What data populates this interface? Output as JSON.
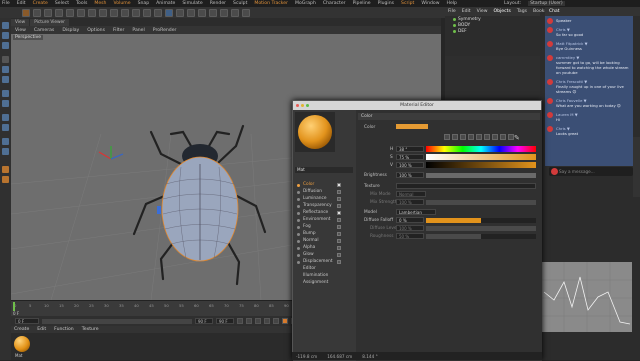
{
  "menubar": [
    "File",
    "Edit",
    "Create",
    "Select",
    "Tools",
    "Mesh",
    "Volume",
    "Snap",
    "Animate",
    "Simulate",
    "Render",
    "Sculpt",
    "Motion Tracker",
    "MoGraph",
    "Character",
    "Pipeline",
    "Plugins",
    "Script",
    "Window",
    "Help"
  ],
  "menubar_right": "Layout:",
  "layout_value": "Startup (User)",
  "viewport": {
    "tabs": [
      "View",
      "Picture Viewer"
    ],
    "menu": [
      "View",
      "Cameras",
      "Display",
      "Options",
      "Filter",
      "Panel",
      "ProRender"
    ],
    "camera_label": "Perspective"
  },
  "timeline": {
    "ticks": [
      "0",
      "5",
      "10",
      "15",
      "20",
      "25",
      "30",
      "35",
      "40",
      "45",
      "50",
      "55",
      "60",
      "65",
      "70",
      "75",
      "80",
      "85",
      "90"
    ],
    "current_frame": "0 F",
    "start_field": "0 F",
    "end_field": "90 F",
    "end_field2": "90 F"
  },
  "material_manager": {
    "menu": [
      "Create",
      "Edit",
      "Function",
      "Texture"
    ],
    "material_label": "Mat"
  },
  "objects_panel": {
    "tabs": [
      "File",
      "Edit",
      "View",
      "Objects",
      "Tags",
      "Bookmarks"
    ],
    "items": [
      "Symmetry",
      "BODY",
      "DEF"
    ]
  },
  "chat": {
    "header": "Chat",
    "messages": [
      {
        "name": "Speaker",
        "text": "Speaker"
      },
      {
        "name": "Chris ▼",
        "text": "So far so good"
      },
      {
        "name": "Matt Fitpatrick ▼",
        "text": "Bye Guinness"
      },
      {
        "name": "carnmtley ▼",
        "text": "summer got to go, will be looking forward to watching the whole stream on youtube"
      },
      {
        "name": "Chris Frescotti ▼",
        "text": "Finally caught up in one of your live streams 😊"
      },
      {
        "name": "Chris Fauvelle ▼",
        "text": "What are you working on today 😊"
      },
      {
        "name": "Lauren M ▼",
        "text": "Hi"
      },
      {
        "name": "Chris ▼",
        "text": "Looks great"
      }
    ],
    "input_placeholder": "Say a message..."
  },
  "material_editor": {
    "title": "Material Editor",
    "material_name": "Mat",
    "channels": [
      {
        "label": "Color",
        "checked": true,
        "selected": true
      },
      {
        "label": "Diffusion",
        "checked": false
      },
      {
        "label": "Luminance",
        "checked": false
      },
      {
        "label": "Transparency",
        "checked": false
      },
      {
        "label": "Reflectance",
        "checked": true
      },
      {
        "label": "Environment",
        "checked": false
      },
      {
        "label": "Fog",
        "checked": false
      },
      {
        "label": "Bump",
        "checked": false
      },
      {
        "label": "Normal",
        "checked": false
      },
      {
        "label": "Alpha",
        "checked": false
      },
      {
        "label": "Glow",
        "checked": false
      },
      {
        "label": "Displacement",
        "checked": false
      },
      {
        "label": "Editor"
      },
      {
        "label": "Illumination"
      },
      {
        "label": "Assignment"
      }
    ],
    "section_color": "Color",
    "color_label": "Color",
    "swatch": "#e49a33",
    "h_label": "H",
    "h_value": "38 °",
    "s_label": "S",
    "s_value": "75 %",
    "v_label": "V",
    "v_value": "100 %",
    "brightness_label": "Brightness",
    "brightness_value": "100 %",
    "texture_label": "Texture",
    "mix_mode_label": "Mix Mode",
    "mix_mode_value": "Normal",
    "mix_strength_label": "Mix Strength",
    "mix_strength_value": "100 %",
    "model_label": "Model",
    "model_value": "Lambertian",
    "diffuse_falloff_label": "Diffuse Falloff",
    "diffuse_falloff_value": "0 %",
    "diffuse_level_label": "Diffuse Level",
    "diffuse_level_value": "100 %",
    "roughness_label": "Roughness",
    "roughness_value": "50 %"
  },
  "status": {
    "x": "-119.8 cm",
    "y": "164.687 cm",
    "z": "8.144 °"
  }
}
